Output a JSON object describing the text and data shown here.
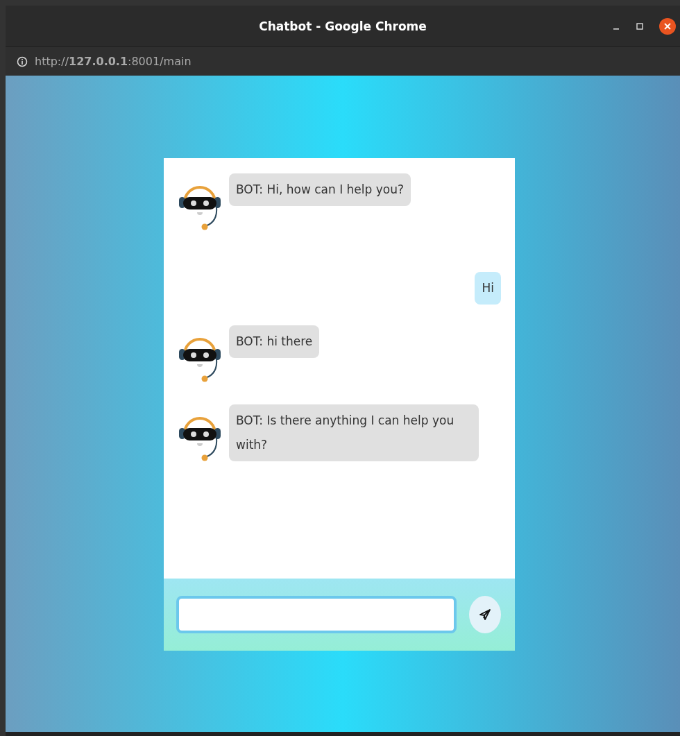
{
  "window": {
    "title": "Chatbot - Google Chrome"
  },
  "address_bar": {
    "url": "http://**127.0.0.1**:8001/main"
  },
  "messages": [
    {
      "kind": "bot",
      "text": "BOT: Hi, how can I help you?"
    },
    {
      "kind": "user",
      "text": "Hi"
    },
    {
      "kind": "bot",
      "text": "BOT: hi there"
    },
    {
      "kind": "bot",
      "text": "BOT: Is there anything I can help you with?"
    }
  ]
}
